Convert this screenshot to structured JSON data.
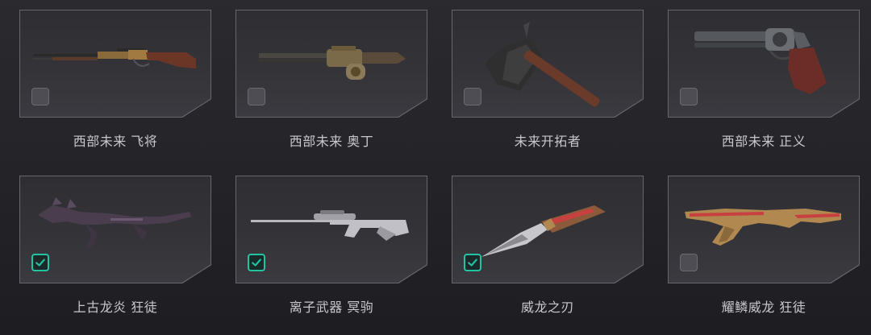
{
  "items": [
    {
      "label": "西部未来 飞将",
      "checked": false,
      "icon": "lever-rifle-icon"
    },
    {
      "label": "西部未来 奥丁",
      "checked": false,
      "icon": "gatling-gun-icon"
    },
    {
      "label": "未来开拓者",
      "checked": false,
      "icon": "axe-icon"
    },
    {
      "label": "西部未来 正义",
      "checked": false,
      "icon": "revolver-icon"
    },
    {
      "label": "上古龙炎 狂徒",
      "checked": true,
      "icon": "dragon-rifle-icon"
    },
    {
      "label": "离子武器 冥驹",
      "checked": true,
      "icon": "sniper-rifle-icon"
    },
    {
      "label": "威龙之刃",
      "checked": true,
      "icon": "knife-icon"
    },
    {
      "label": "耀鳞威龙 狂徒",
      "checked": false,
      "icon": "gold-rifle-icon"
    }
  ],
  "colors": {
    "accent": "#22c3a3",
    "label": "#c7c7cc",
    "card_border": "#66666c"
  }
}
